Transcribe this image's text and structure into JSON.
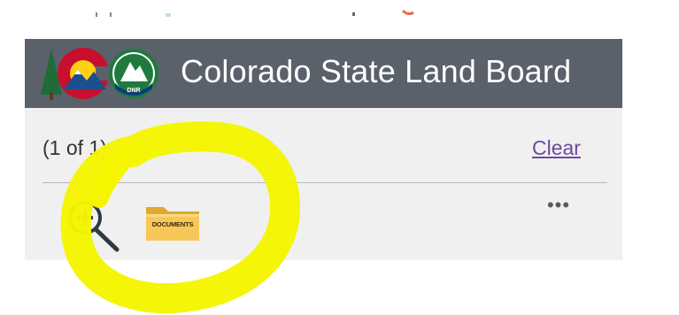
{
  "header": {
    "title": "Colorado State Land Board",
    "background_color": "#5b616b",
    "logo_left": "colorado-c-logo",
    "logo_right": "dnr-logo",
    "logo_right_text": "DNR"
  },
  "popup": {
    "count_label": "(1 of 1)",
    "clear_label": "Clear",
    "actions": {
      "zoom_icon": "zoom-in-magnifier",
      "documents_icon": "folder",
      "documents_label": "DOCUMENTS",
      "more_label": "•••"
    }
  },
  "annotation": {
    "color": "#f5f500",
    "shape": "hand-drawn circle around zoom and documents buttons"
  }
}
